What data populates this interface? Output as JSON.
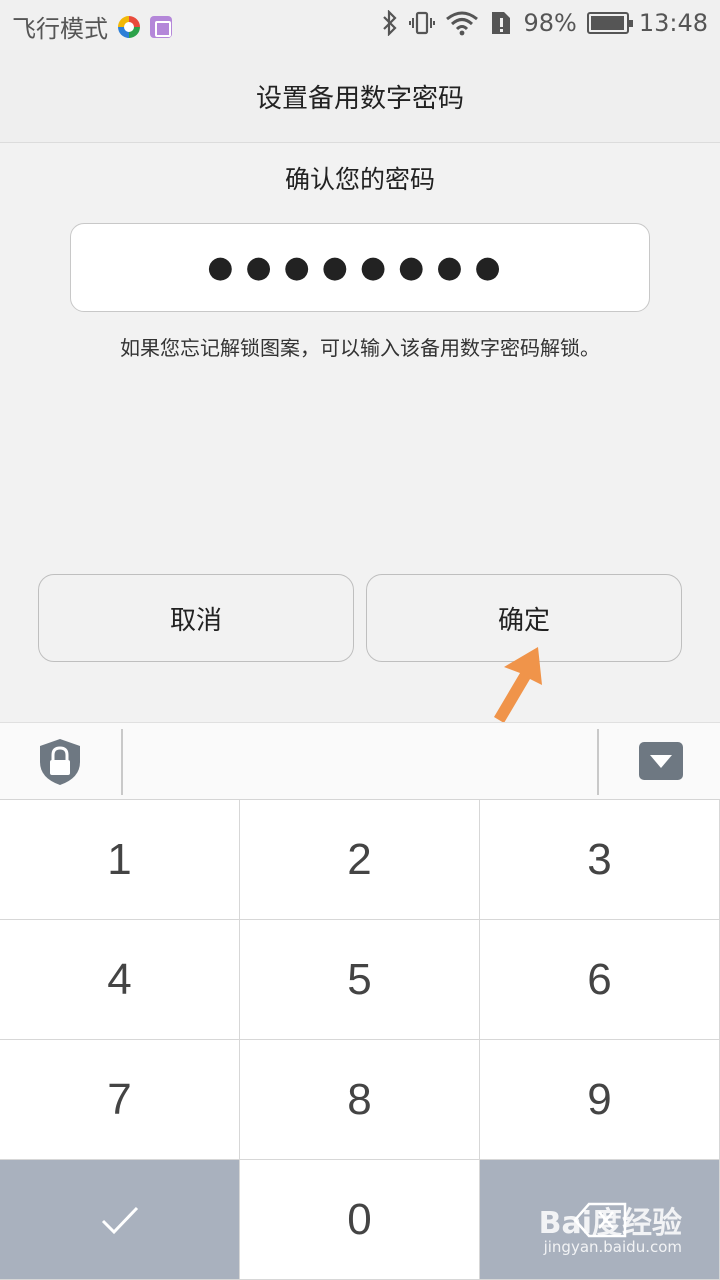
{
  "status_bar": {
    "mode": "飞行模式",
    "battery": "98%",
    "time": "13:48"
  },
  "header": {
    "title": "设置备用数字密码"
  },
  "main": {
    "confirm_title": "确认您的密码",
    "password_mask": "●●●●●●●●",
    "hint": "如果您忘记解锁图案，可以输入该备用数字密码解锁。",
    "cancel_label": "取消",
    "ok_label": "确定"
  },
  "keypad": {
    "keys": [
      "1",
      "2",
      "3",
      "4",
      "5",
      "6",
      "7",
      "8",
      "9",
      "0"
    ]
  },
  "watermark": {
    "logo": "Bai度经验",
    "url": "jingyan.baidu.com"
  },
  "colors": {
    "arrow": "#f0944a",
    "key_dark": "#a9b1be",
    "lock": "#6e7882"
  }
}
